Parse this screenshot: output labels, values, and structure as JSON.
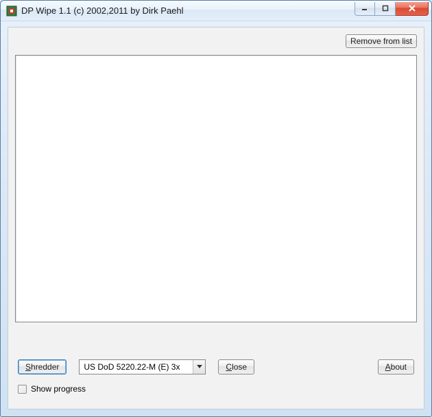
{
  "window": {
    "title": "DP Wipe 1.1 (c) 2002,2011 by Dirk Paehl"
  },
  "buttons": {
    "remove_from_list": "Remove from list",
    "shredder_pre": "S",
    "shredder_post": "hredder",
    "close_pre": "C",
    "close_post": "lose",
    "about_pre": "A",
    "about_post": "bout"
  },
  "combo": {
    "selected": "US DoD 5220.22-M (E) 3x"
  },
  "checkbox": {
    "show_progress_label": "Show progress",
    "checked": false
  },
  "list": {
    "items": []
  }
}
